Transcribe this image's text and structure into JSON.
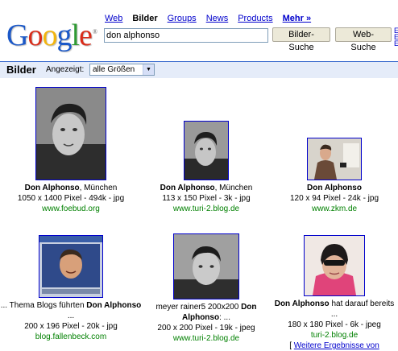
{
  "header": {
    "logo_letters": [
      "G",
      "o",
      "o",
      "g",
      "l",
      "e"
    ],
    "logo_colors": [
      "#1b58c8",
      "#d92c1a",
      "#f2b50f",
      "#1b58c8",
      "#2f9a33",
      "#d92c1a"
    ],
    "tabs": [
      {
        "label": "Web",
        "active": false
      },
      {
        "label": "Bilder",
        "active": true
      },
      {
        "label": "Groups",
        "active": false
      },
      {
        "label": "News",
        "active": false
      },
      {
        "label": "Products",
        "active": false
      },
      {
        "label": "Mehr »",
        "active": false
      }
    ],
    "search_value": "don alphonso",
    "image_search_button": "Bilder-Suche",
    "web_search_button": "Web-Suche"
  },
  "bar": {
    "title": "Bilder",
    "filter_label": "Angezeigt:",
    "filter_value": "alle Größen"
  },
  "results": [
    {
      "title_bold": "Don Alphonso",
      "title_rest": ", München",
      "meta": "1050 x 1400 Pixel - 494k - jpg",
      "url": "www.foebud.org"
    },
    {
      "title_bold": "Don Alphonso",
      "title_rest": ", München",
      "meta": "113 x 150 Pixel - 3k - jpg",
      "url": "www.turi-2.blog.de"
    },
    {
      "title_bold": "Don Alphonso",
      "title_rest": "",
      "meta": "120 x 94 Pixel - 24k - jpg",
      "url": "www.zkm.de"
    },
    {
      "title_pre": "... Thema Blogs führten ",
      "title_bold": "Don Alphonso",
      "title_rest": " ...",
      "meta": "200 x 196 Pixel - 20k - jpg",
      "url": "blog.fallenbeck.com"
    },
    {
      "title_pre": "meyer rainer5 200x200 ",
      "title_bold": "Don Alphonso",
      "title_rest": ": ...",
      "meta": "200 x 200 Pixel - 19k - jpeg",
      "url": "www.turi-2.blog.de"
    },
    {
      "title_bold": "Don Alphonso",
      "title_rest": " hat darauf bereits ...",
      "meta": "180 x 180 Pixel - 6k - jpeg",
      "url": "turi-2.blog.de"
    }
  ],
  "more_results": "Weitere Ergebnisse von",
  "colors": {
    "link": "#0000cc",
    "url": "#008000",
    "bar_bg": "#e5ecf9",
    "bar_border": "#3366cc"
  }
}
